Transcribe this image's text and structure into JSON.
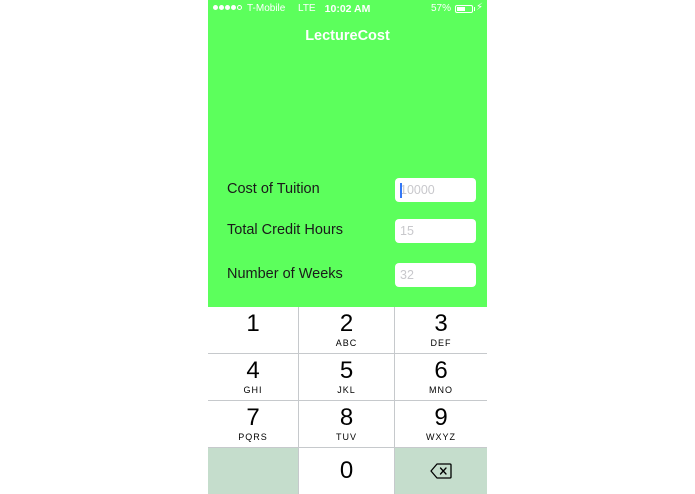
{
  "status_bar": {
    "carrier": "T-Mobile",
    "network": "LTE",
    "time": "10:02 AM",
    "battery_percent": "57%",
    "battery_level": 0.57,
    "signal_bars_filled": 4,
    "signal_bars_total": 5,
    "icons": [
      "signal-dots-icon",
      "battery-icon",
      "charging-bolt-icon"
    ]
  },
  "nav": {
    "title": "LectureCost"
  },
  "form": {
    "tuition": {
      "label": "Cost of Tuition",
      "placeholder": "10000",
      "value": ""
    },
    "credit_hours": {
      "label": "Total Credit Hours",
      "placeholder": "15",
      "value": ""
    },
    "weeks": {
      "label": "Number of Weeks",
      "placeholder": "32",
      "value": ""
    }
  },
  "keypad": {
    "keys": [
      {
        "digit": "1",
        "letters": ""
      },
      {
        "digit": "2",
        "letters": "ABC"
      },
      {
        "digit": "3",
        "letters": "DEF"
      },
      {
        "digit": "4",
        "letters": "GHI"
      },
      {
        "digit": "5",
        "letters": "JKL"
      },
      {
        "digit": "6",
        "letters": "MNO"
      },
      {
        "digit": "7",
        "letters": "PQRS"
      },
      {
        "digit": "8",
        "letters": "TUV"
      },
      {
        "digit": "9",
        "letters": "WXYZ"
      },
      {
        "digit": "0",
        "letters": ""
      }
    ],
    "delete_icon": "backspace-icon"
  },
  "colors": {
    "background": "#5cff5c",
    "title_text": "#ffffff",
    "caret": "#3478f6",
    "keypad_dim": "#c5ddcc"
  }
}
